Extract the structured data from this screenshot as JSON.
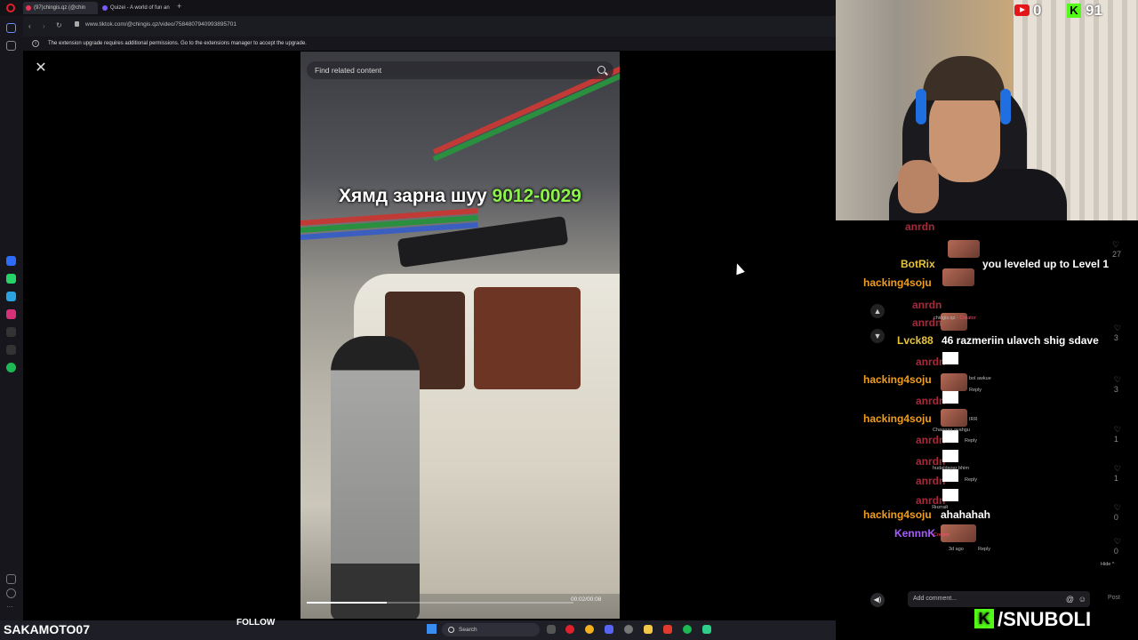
{
  "browser": {
    "tabs": [
      {
        "label": "(97)chingis.qz (@chin"
      },
      {
        "label": "Quizei - A world of fun an"
      }
    ],
    "new_tab_label": "+",
    "url": "www.tiktok.com/@chingis.qz/video/7584807940993895701",
    "infobar_text": "The extension upgrade requires additional permissions. Go to the extensions manager to accept the upgrade."
  },
  "tiktok": {
    "close_label": "✕",
    "search_placeholder": "Find related content",
    "caption_text": "Хямд зарна шуу",
    "caption_number": "9012-0029",
    "time": "00:02/00:08",
    "progress": 0.3,
    "add_comment_placeholder": "Add comment...",
    "post_label": "Post",
    "hide_label": "Hide ^",
    "reply_age": "3d ago",
    "reply_label": "Reply"
  },
  "chat": {
    "messages": [
      {
        "user": "BotRix",
        "user_color": "#e8c43a",
        "text": "you leveled up to Level 1"
      },
      {
        "user": "hacking4soju",
        "user_color": "#f29d1b",
        "text": ""
      },
      {
        "user": "Lvck88",
        "user_color": "#e8c43a",
        "text": "46 razmeriin ulavch shig sdave"
      },
      {
        "user": "hacking4soju",
        "user_color": "#f29d1b",
        "text": ""
      },
      {
        "user": "hacking4soju",
        "user_color": "#f29d1b",
        "text": ""
      },
      {
        "user": "hacking4soju",
        "user_color": "#f29d1b",
        "text": "ahahahah"
      },
      {
        "user": "KennnK",
        "user_color": "#a85bff",
        "text": ""
      }
    ],
    "faded_user": "anrdn",
    "faded_user_color": "#d2324a",
    "tiktok_comments": [
      {
        "text": "chingis.qz",
        "badge": "Creator"
      },
      {
        "text": "bol awkue"
      },
      {
        "text": "IRR"
      },
      {
        "text": "Chaaaaa avahgu"
      },
      {
        "text": "hudaldagar bhim"
      },
      {
        "text": "Янзтай"
      }
    ],
    "like_counts": [
      "27",
      "3",
      "3",
      "1",
      "1",
      "0",
      "0"
    ]
  },
  "stream": {
    "streamer_name": "SAKAMOTO07",
    "follow_label": "FOLLOW",
    "yt_count": "0",
    "kick_count": "91",
    "kick_letter": "K",
    "brand_text": "/SNUBOLI"
  },
  "taskbar": {
    "search_label": "Search"
  },
  "colors": {
    "accent_green": "#53fc18",
    "youtube_red": "#e5161a",
    "caption_number": "#8cf24b"
  }
}
